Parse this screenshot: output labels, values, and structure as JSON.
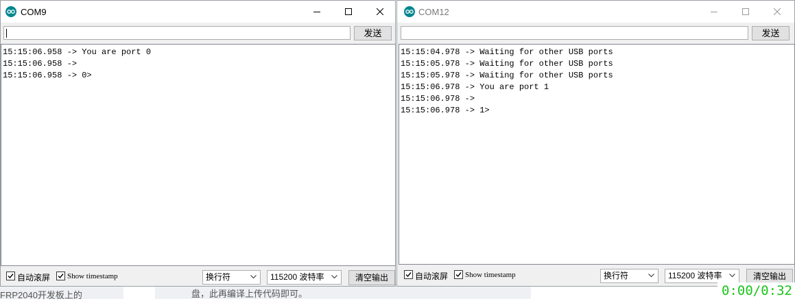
{
  "background": {
    "left_text": "FRP2040开发板上的",
    "center_text": "盘，此再编译上传代码即可。"
  },
  "windows": [
    {
      "title": "COM9",
      "send_value": "",
      "send_label": "发送",
      "lines": [
        "15:15:06.958 -> You are port 0",
        "15:15:06.958 -> ",
        "15:15:06.958 -> 0>"
      ],
      "autoscroll_label": "自动滚屏",
      "autoscroll_checked": true,
      "timestamp_label": "Show timestamp",
      "timestamp_checked": true,
      "line_ending": "换行符",
      "baud": "115200 波特率",
      "clear_label": "清空输出"
    },
    {
      "title": "COM12",
      "send_value": "",
      "send_label": "发送",
      "lines": [
        "15:15:04.978 -> Waiting for other USB ports",
        "15:15:05.978 -> Waiting for other USB ports",
        "15:15:05.978 -> Waiting for other USB ports",
        "15:15:06.978 -> You are port 1",
        "15:15:06.978 -> ",
        "15:15:06.978 -> 1>"
      ],
      "autoscroll_label": "自动滚屏",
      "autoscroll_checked": true,
      "timestamp_label": "Show timestamp",
      "timestamp_checked": true,
      "line_ending": "换行符",
      "baud": "115200 波特率",
      "clear_label": "清空输出"
    }
  ],
  "player": {
    "time": "0:00/0:32",
    "color": "#19c519"
  },
  "colors": {
    "arduino_teal": "#00878f"
  }
}
